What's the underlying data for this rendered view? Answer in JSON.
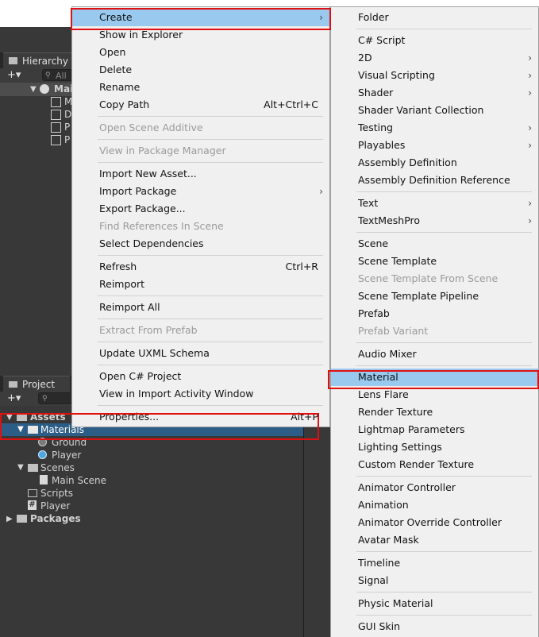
{
  "hierarchy": {
    "tab_label": "Hierarchy",
    "add_label": "+▾",
    "search_placeholder": "All",
    "scene_root": "Mai",
    "children": [
      "M",
      "D",
      "P",
      "P"
    ]
  },
  "project": {
    "tab_label": "Project",
    "add_label": "+▾",
    "tree": {
      "assets": "Assets",
      "materials": "Materials",
      "ground": "Ground",
      "player_material": "Player",
      "scenes": "Scenes",
      "main_scene": "Main Scene",
      "scripts": "Scripts",
      "player_script": "Player",
      "packages": "Packages"
    }
  },
  "context_menu": {
    "items": [
      {
        "label": "Create",
        "submenu": true,
        "highlighted": true
      },
      {
        "label": "Show in Explorer"
      },
      {
        "label": "Open"
      },
      {
        "label": "Delete"
      },
      {
        "label": "Rename"
      },
      {
        "label": "Copy Path",
        "shortcut": "Alt+Ctrl+C"
      },
      {
        "label": "Open Scene Additive",
        "disabled": true
      },
      {
        "label": "View in Package Manager",
        "disabled": true
      },
      {
        "label": "Import New Asset..."
      },
      {
        "label": "Import Package",
        "submenu": true
      },
      {
        "label": "Export Package..."
      },
      {
        "label": "Find References In Scene",
        "disabled": true
      },
      {
        "label": "Select Dependencies"
      },
      {
        "label": "Refresh",
        "shortcut": "Ctrl+R"
      },
      {
        "label": "Reimport"
      },
      {
        "label": "Reimport All"
      },
      {
        "label": "Extract From Prefab",
        "disabled": true
      },
      {
        "label": "Update UXML Schema"
      },
      {
        "label": "Open C# Project"
      },
      {
        "label": "View in Import Activity Window"
      },
      {
        "label": "Properties...",
        "shortcut": "Alt+P"
      }
    ]
  },
  "create_submenu": {
    "items": [
      {
        "label": "Folder"
      },
      {
        "label": "C# Script"
      },
      {
        "label": "2D",
        "submenu": true
      },
      {
        "label": "Visual Scripting",
        "submenu": true
      },
      {
        "label": "Shader",
        "submenu": true
      },
      {
        "label": "Shader Variant Collection"
      },
      {
        "label": "Testing",
        "submenu": true
      },
      {
        "label": "Playables",
        "submenu": true
      },
      {
        "label": "Assembly Definition"
      },
      {
        "label": "Assembly Definition Reference"
      },
      {
        "label": "Text",
        "submenu": true
      },
      {
        "label": "TextMeshPro",
        "submenu": true
      },
      {
        "label": "Scene"
      },
      {
        "label": "Scene Template"
      },
      {
        "label": "Scene Template From Scene",
        "disabled": true
      },
      {
        "label": "Scene Template Pipeline"
      },
      {
        "label": "Prefab"
      },
      {
        "label": "Prefab Variant",
        "disabled": true
      },
      {
        "label": "Audio Mixer"
      },
      {
        "label": "Material",
        "highlighted": true
      },
      {
        "label": "Lens Flare"
      },
      {
        "label": "Render Texture"
      },
      {
        "label": "Lightmap Parameters"
      },
      {
        "label": "Lighting Settings"
      },
      {
        "label": "Custom Render Texture"
      },
      {
        "label": "Animator Controller"
      },
      {
        "label": "Animation"
      },
      {
        "label": "Animator Override Controller"
      },
      {
        "label": "Avatar Mask"
      },
      {
        "label": "Timeline"
      },
      {
        "label": "Signal"
      },
      {
        "label": "Physic Material"
      },
      {
        "label": "GUI Skin"
      }
    ]
  },
  "colors": {
    "highlight": "#99c9ef",
    "annotation": "#e01010",
    "selection": "#2c5d87"
  }
}
